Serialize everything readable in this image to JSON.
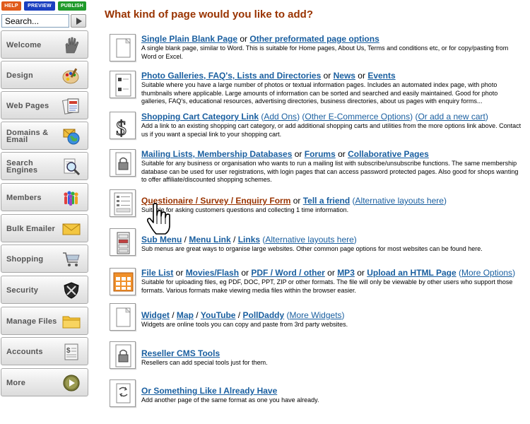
{
  "sidebar": {
    "top_buttons": [
      {
        "label": "HELP",
        "color": "#e05a1a"
      },
      {
        "label": "PREVIEW",
        "color": "#1a3fc0"
      },
      {
        "label": "PUBLISH",
        "color": "#1f9a2a"
      }
    ],
    "search_placeholder": "Search...",
    "nav": [
      {
        "label": "Welcome",
        "icon": "hand-icon"
      },
      {
        "label": "Design",
        "icon": "palette-icon"
      },
      {
        "label": "Web Pages",
        "icon": "pages-icon"
      },
      {
        "label": "Domains & Email",
        "icon": "globe-mail-icon"
      },
      {
        "label": "Search Engines",
        "icon": "magnifier-icon"
      },
      {
        "label": "Members",
        "icon": "people-icon"
      },
      {
        "label": "Bulk Emailer",
        "icon": "envelope-icon"
      },
      {
        "label": "Shopping",
        "icon": "cart-icon"
      },
      {
        "label": "Security",
        "icon": "shield-icon"
      },
      {
        "label": "Manage Files",
        "icon": "folder-icon"
      },
      {
        "label": "Accounts",
        "icon": "ledger-icon"
      },
      {
        "label": "More",
        "icon": "play-icon"
      }
    ]
  },
  "main": {
    "heading": "What kind of page would you like to add?",
    "rows": [
      {
        "icon": "blank-page-icon",
        "parts": [
          {
            "t": "link",
            "v": "Single Plain Blank Page"
          },
          {
            "t": "sep",
            "v": " or "
          },
          {
            "t": "link",
            "v": "Other preformated page options"
          }
        ],
        "desc": "A single blank page, similar to Word. This is suitable for Home pages, About Us, Terms and conditions etc, or for copy/pasting from Word or Excel."
      },
      {
        "icon": "gallery-page-icon",
        "parts": [
          {
            "t": "link",
            "v": "Photo Galleries, FAQ's, Lists and Directories"
          },
          {
            "t": "sep",
            "v": " or "
          },
          {
            "t": "link",
            "v": "News"
          },
          {
            "t": "sep",
            "v": " or "
          },
          {
            "t": "link",
            "v": "Events"
          }
        ],
        "desc": "Suitable where you have a large number of photos or textual information pages. Includes an automated index page, with photo thumbnails where applicable. Large amounts of information can be sorted and searched and easily maintained. Good for photo galleries, FAQ's, educational resources, advertising directories, business directories, about us pages with enquiry forms..."
      },
      {
        "icon": "dollar-icon",
        "parts": [
          {
            "t": "link",
            "v": "Shopping Cart Category Link"
          },
          {
            "t": "p",
            "v": " ("
          },
          {
            "t": "linkn",
            "v": "Add Ons"
          },
          {
            "t": "p",
            "v": ") ("
          },
          {
            "t": "linkn",
            "v": "Other E-Commerce Options"
          },
          {
            "t": "p",
            "v": ") ("
          },
          {
            "t": "linkn",
            "v": "Or add a new cart"
          },
          {
            "t": "p",
            "v": ")"
          }
        ],
        "desc": "Add a link to an existing shopping cart category, or add additional shopping carts and utilities from the more options link above. Contact us if you want a special link to your shopping cart."
      },
      {
        "icon": "padlock-page-icon",
        "parts": [
          {
            "t": "link",
            "v": "Mailing Lists, Membership Databases"
          },
          {
            "t": "sep",
            "v": " or "
          },
          {
            "t": "link",
            "v": "Forums"
          },
          {
            "t": "sep",
            "v": " or "
          },
          {
            "t": "link",
            "v": "Collaborative Pages"
          }
        ],
        "desc": "Suitable for any business or organisation who wants to run a mailing list with subscribe/unsubscribe functions. The same membership database can be used for user registrations, with login pages that can access password protected pages. Also good for shops wanting to offer affiliate/discounted shopping schemes."
      },
      {
        "icon": "form-page-icon",
        "parts": [
          {
            "t": "link-active",
            "v": "Questionaire / Survey / Enquiry Form"
          },
          {
            "t": "sep",
            "v": " or "
          },
          {
            "t": "link",
            "v": "Tell a friend"
          },
          {
            "t": "p",
            "v": " ("
          },
          {
            "t": "linkn",
            "v": "Alternative layouts here"
          },
          {
            "t": "p",
            "v": ")"
          }
        ],
        "desc": "Suitable for asking customers questions and collecting 1 time information."
      },
      {
        "icon": "submenu-icon",
        "parts": [
          {
            "t": "link",
            "v": "Sub Menu"
          },
          {
            "t": "sep",
            "v": " / "
          },
          {
            "t": "link",
            "v": "Menu Link"
          },
          {
            "t": "sep",
            "v": " / "
          },
          {
            "t": "link",
            "v": "Links"
          },
          {
            "t": "p",
            "v": " ("
          },
          {
            "t": "linkn",
            "v": "Alternative layouts here"
          },
          {
            "t": "p",
            "v": ")"
          }
        ],
        "desc": "Sub menus are great ways to organise large websites. Other common page options for most websites can be found here."
      },
      {
        "icon": "files-icon",
        "parts": [
          {
            "t": "link",
            "v": "File List"
          },
          {
            "t": "sep",
            "v": " or "
          },
          {
            "t": "link",
            "v": "Movies/Flash"
          },
          {
            "t": "sep",
            "v": " or "
          },
          {
            "t": "link",
            "v": "PDF / Word / other"
          },
          {
            "t": "sep",
            "v": " or "
          },
          {
            "t": "link",
            "v": "MP3"
          },
          {
            "t": "sep",
            "v": " or "
          },
          {
            "t": "link",
            "v": "Upload an HTML Page"
          },
          {
            "t": "p",
            "v": " ("
          },
          {
            "t": "linkn",
            "v": "More Options"
          },
          {
            "t": "p",
            "v": ")"
          }
        ],
        "desc": "Suitable for uploading files, eg PDF, DOC, PPT, ZIP or other formats. The file will only be viewable by other users who support those formats. Various formats make viewing media files within the browser easier."
      },
      {
        "icon": "widget-page-icon",
        "parts": [
          {
            "t": "link",
            "v": "Widget"
          },
          {
            "t": "sep",
            "v": " / "
          },
          {
            "t": "link",
            "v": "Map"
          },
          {
            "t": "sep",
            "v": " / "
          },
          {
            "t": "link",
            "v": "YouTube"
          },
          {
            "t": "sep",
            "v": " / "
          },
          {
            "t": "link",
            "v": "PollDaddy"
          },
          {
            "t": "p",
            "v": " ("
          },
          {
            "t": "linkn",
            "v": "More Widgets"
          },
          {
            "t": "p",
            "v": ")"
          }
        ],
        "desc": "Widgets are online tools you can copy and paste from 3rd party websites."
      },
      {
        "icon": "reseller-page-icon",
        "parts": [
          {
            "t": "link",
            "v": "Reseller CMS Tools"
          }
        ],
        "desc": "Resellers can add special tools just for them."
      },
      {
        "icon": "copy-page-icon",
        "parts": [
          {
            "t": "link",
            "v": "Or Something Like I Already Have"
          }
        ],
        "desc": "Add another page of the same format as one you have already."
      }
    ]
  },
  "colors": {
    "heading": "#993300",
    "link": "#1a5fa0",
    "active_link": "#993300"
  }
}
